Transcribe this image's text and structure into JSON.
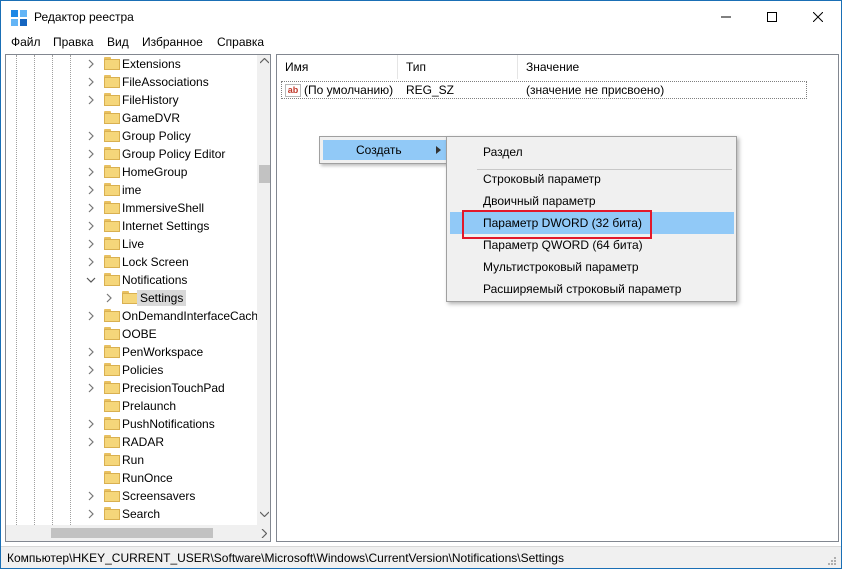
{
  "window": {
    "title": "Редактор реестра",
    "app_icon": "regedit-icon"
  },
  "menu": {
    "items": [
      "Файл",
      "Правка",
      "Вид",
      "Избранное",
      "Справка"
    ]
  },
  "tree": {
    "items": [
      {
        "label": "Extensions",
        "expand": "closed"
      },
      {
        "label": "FileAssociations",
        "expand": "closed"
      },
      {
        "label": "FileHistory",
        "expand": "closed"
      },
      {
        "label": "GameDVR",
        "expand": "none"
      },
      {
        "label": "Group Policy",
        "expand": "closed"
      },
      {
        "label": "Group Policy Editor",
        "expand": "closed"
      },
      {
        "label": "HomeGroup",
        "expand": "closed"
      },
      {
        "label": "ime",
        "expand": "closed"
      },
      {
        "label": "ImmersiveShell",
        "expand": "closed"
      },
      {
        "label": "Internet Settings",
        "expand": "closed"
      },
      {
        "label": "Live",
        "expand": "closed"
      },
      {
        "label": "Lock Screen",
        "expand": "closed"
      },
      {
        "label": "Notifications",
        "expand": "open"
      },
      {
        "label": "Settings",
        "expand": "closed",
        "child": true,
        "selected": true
      },
      {
        "label": "OnDemandInterfaceCach",
        "expand": "closed"
      },
      {
        "label": "OOBE",
        "expand": "none"
      },
      {
        "label": "PenWorkspace",
        "expand": "closed"
      },
      {
        "label": "Policies",
        "expand": "closed"
      },
      {
        "label": "PrecisionTouchPad",
        "expand": "closed"
      },
      {
        "label": "Prelaunch",
        "expand": "none"
      },
      {
        "label": "PushNotifications",
        "expand": "closed"
      },
      {
        "label": "RADAR",
        "expand": "closed"
      },
      {
        "label": "Run",
        "expand": "none"
      },
      {
        "label": "RunOnce",
        "expand": "none"
      },
      {
        "label": "Screensavers",
        "expand": "closed"
      },
      {
        "label": "Search",
        "expand": "closed"
      }
    ]
  },
  "values": {
    "columns": {
      "name": "Имя",
      "type": "Тип",
      "data": "Значение"
    },
    "rows": [
      {
        "icon": "string-value-icon",
        "icon_text": "ab",
        "name": "(По умолчанию)",
        "type": "REG_SZ",
        "data": "(значение не присвоено)"
      }
    ]
  },
  "context_menu": {
    "parent_label": "Создать",
    "submenu": [
      "Раздел",
      "Строковый параметр",
      "Двоичный параметр",
      "Параметр DWORD (32 бита)",
      "Параметр QWORD (64 бита)",
      "Мультистроковый параметр",
      "Расширяемый строковый параметр"
    ],
    "highlighted": "Параметр DWORD (32 бита)",
    "highlight_color": "#91c9f7",
    "annotation_color": "#e2182b"
  },
  "status": {
    "path": "Компьютер\\HKEY_CURRENT_USER\\Software\\Microsoft\\Windows\\CurrentVersion\\Notifications\\Settings"
  }
}
